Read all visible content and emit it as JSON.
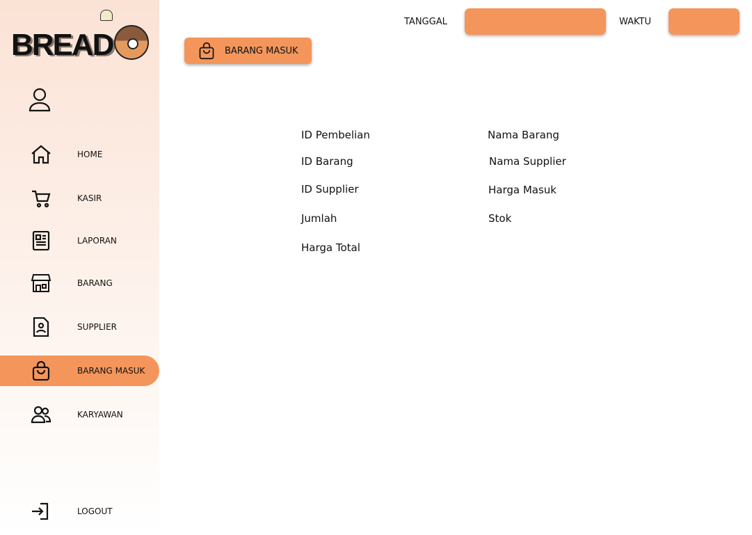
{
  "brand": {
    "logo_text": "BREAD"
  },
  "sidebar": {
    "items": [
      {
        "label": "HOME",
        "icon": "home-icon"
      },
      {
        "label": "KASIR",
        "icon": "cart-icon"
      },
      {
        "label": "LAPORAN",
        "icon": "newspaper-icon"
      },
      {
        "label": "BARANG",
        "icon": "store-icon"
      },
      {
        "label": "SUPPLIER",
        "icon": "contact-file-icon"
      },
      {
        "label": "BARANG MASUK",
        "icon": "shopping-bag-icon",
        "active": true
      },
      {
        "label": "KARYAWAN",
        "icon": "users-icon"
      },
      {
        "label": "LOGOUT",
        "icon": "logout-icon"
      }
    ]
  },
  "header": {
    "date_label": "TANGGAL",
    "date_value": "",
    "time_label": "WAKTU",
    "time_value": ""
  },
  "page": {
    "title_button": "BARANG MASUK"
  },
  "form": {
    "left": [
      "ID Pembelian",
      "ID Barang",
      "ID Supplier",
      "Jumlah",
      "Harga Total"
    ],
    "right": [
      "Nama Barang",
      "Nama Supplier",
      "Harga Masuk",
      "Stok"
    ]
  },
  "colors": {
    "accent": "#f4965b",
    "sidebar_top": "#fbe2d5"
  }
}
